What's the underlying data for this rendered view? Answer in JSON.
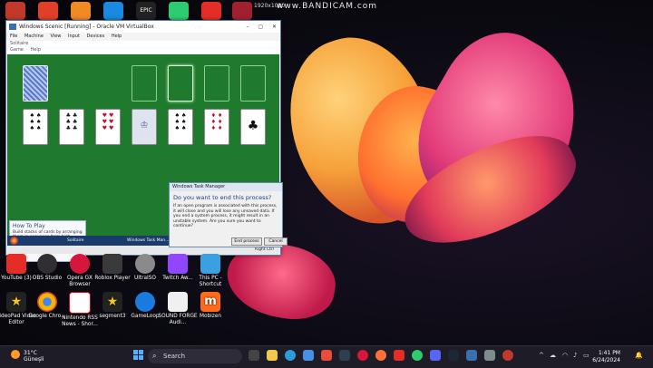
{
  "topbar": {
    "resolution": "1920x1080",
    "watermark": "www.BANDICAM.com"
  },
  "vm_window": {
    "title": "Windows Scenic [Running] - Oracle VM VirtualBox",
    "controls": [
      "–",
      "▢",
      "✕"
    ],
    "menu": [
      "File",
      "Machine",
      "View",
      "Input",
      "Devices",
      "Help"
    ],
    "game_title": "Solitaire",
    "game_menu": [
      "Game",
      "Help"
    ],
    "howto_title": "How To Play",
    "howto_text": "Build stacks of cards by arranging them in sequence from high number to low, in alternating suit colors red and black. Click and drag a card to move it.",
    "taskbar_items": [
      "Solitaire",
      "Windows Task Man..."
    ],
    "status_right": "Right Ctrl"
  },
  "dialog": {
    "title": "Windows Task Manager",
    "question": "Do you want to end this process?",
    "body": "If an open program is associated with this process, it will close and you will lose any unsaved data. If you end a system process, it might result in an unstable system. Are you sure you want to continue?",
    "end_button": "End process",
    "cancel_button": "Cancel"
  },
  "desktop_icons_row1": [
    {
      "label": "YouTube (3)",
      "color": "#e52d27"
    },
    {
      "label": "OBS Studio",
      "color": "#302e31"
    },
    {
      "label": "Opera GX Browser",
      "color": "#d8163c"
    },
    {
      "label": "Roblox Player",
      "color": "#3a3a3a"
    },
    {
      "label": "UltraISO",
      "color": "#8a8a8a"
    },
    {
      "label": "Twitch Aw...",
      "color": "#9146ff"
    },
    {
      "label": "This PC - Shortcut",
      "color": "#3aa0e0"
    }
  ],
  "desktop_icons_row2": [
    {
      "label": "VideoPad Video Editor",
      "color": "#222"
    },
    {
      "label": "Google Chro...",
      "color": "#f4b400"
    },
    {
      "label": "Nintendo RSS News - Shor...",
      "color": "#e60012"
    },
    {
      "label": "segment3",
      "color": "#222"
    },
    {
      "label": "GameLoop",
      "color": "#1a7ae0"
    },
    {
      "label": "SOUND FORGE Audi...",
      "color": "#f0f0f0"
    },
    {
      "label": "Mobizen",
      "color": "#ff6a1a"
    }
  ],
  "taskbar": {
    "weather_temp": "31°C",
    "weather_desc": "Güneşli",
    "search_label": "Search",
    "time": "1:41 PM",
    "date": "6/24/2024"
  },
  "colors": {
    "felt": "#1f7a2e",
    "taskbar": "#1e1c26"
  }
}
